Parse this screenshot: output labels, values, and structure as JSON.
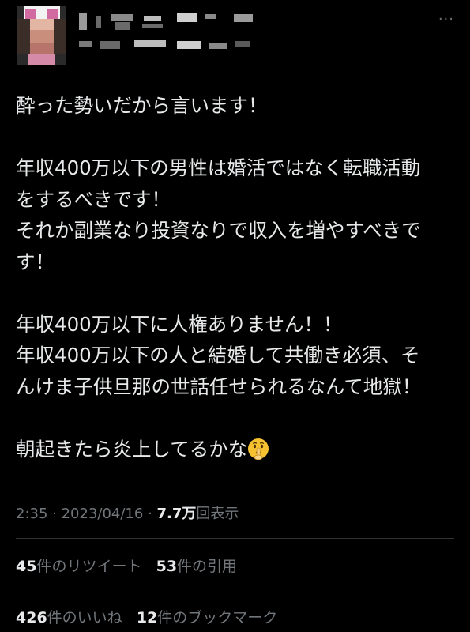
{
  "tweet": {
    "lines": [
      "酔った勢いだから言います！",
      "",
      "年収400万以下の男性は婚活ではなく転職活動",
      "をするべきです！",
      "それか副業なり投資なりで収入を増やすべきで",
      "す！",
      "",
      "年収400万以下に人権ありません！！",
      "年収400万以下の人と結婚して共働き必須、そ",
      "んけま子供旦那の世話任せられるなんて地獄！",
      "",
      "朝起きたら炎上してるかな"
    ],
    "emoji_icon": "shushing-face-emoji"
  },
  "meta": {
    "time": "2:35",
    "sep1": " · ",
    "date": "2023/04/16",
    "sep2": " · ",
    "views_value": "7.7万",
    "views_label": "回表示"
  },
  "stats": {
    "retweets_count": "45",
    "retweets_label": "件のリツイート",
    "quotes_count": "53",
    "quotes_label": "件の引用",
    "likes_count": "426",
    "likes_label": "件のいいね",
    "bookmarks_count": "12",
    "bookmarks_label": "件のブックマーク"
  },
  "header": {
    "more_icon": "more-horizontal-icon",
    "more_glyph": "···"
  },
  "colors": {
    "background": "#000000",
    "text": "#e7e9ea",
    "secondary": "#71767b",
    "divider": "#2f3336"
  }
}
